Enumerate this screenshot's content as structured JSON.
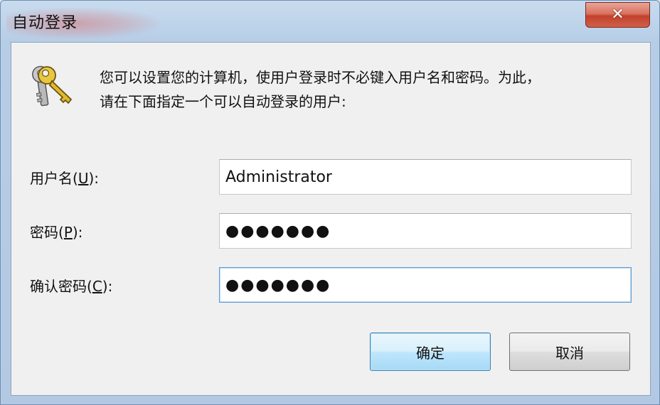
{
  "window": {
    "title": "自动登录",
    "close_symbol": "✕"
  },
  "dialog": {
    "icon": "keys-icon",
    "description_line1": "您可以设置您的计算机，使用户登录时不必键入用户名和密码。为此，",
    "description_line2": "请在下面指定一个可以自动登录的用户:"
  },
  "fields": {
    "username": {
      "label_prefix": "用户名(",
      "label_hotkey": "U",
      "label_suffix": "):",
      "value": "Administrator"
    },
    "password": {
      "label_prefix": "密码(",
      "label_hotkey": "P",
      "label_suffix": "):",
      "value": "●●●●●●●"
    },
    "confirm_password": {
      "label_prefix": "确认密码(",
      "label_hotkey": "C",
      "label_suffix": "):",
      "value": "●●●●●●●"
    }
  },
  "buttons": {
    "ok_label": "确定",
    "cancel_label": "取消"
  }
}
